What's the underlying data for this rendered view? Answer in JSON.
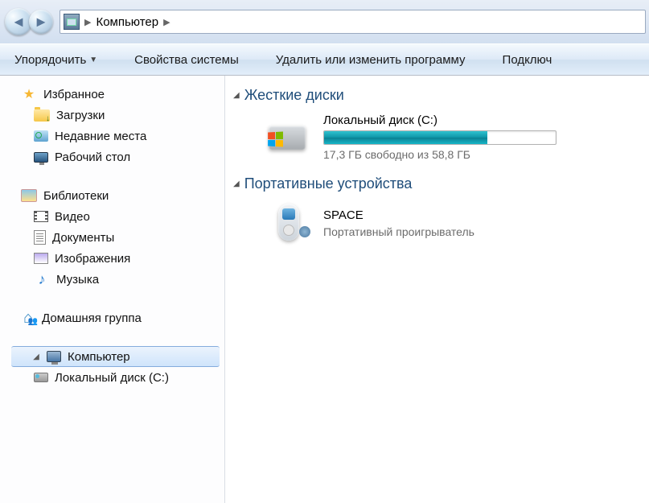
{
  "addressbar": {
    "location": "Компьютер"
  },
  "toolbar": {
    "organize": "Упорядочить",
    "sys_props": "Свойства системы",
    "uninstall": "Удалить или изменить программу",
    "connect": "Подключ"
  },
  "nav": {
    "favorites": "Избранное",
    "downloads": "Загрузки",
    "recent": "Недавние места",
    "desktop": "Рабочий стол",
    "libraries": "Библиотеки",
    "videos": "Видео",
    "documents": "Документы",
    "pictures": "Изображения",
    "music": "Музыка",
    "homegroup": "Домашняя группа",
    "computer": "Компьютер",
    "local_disk_c": "Локальный диск (C:)"
  },
  "groups": {
    "hdd": "Жесткие диски",
    "portable": "Портативные устройства"
  },
  "drives": {
    "c": {
      "name": "Локальный диск (C:)",
      "free_text": "17,3 ГБ свободно из 58,8 ГБ",
      "free_gb": 17.3,
      "total_gb": 58.8,
      "used_percent": 70.6
    }
  },
  "devices": {
    "space": {
      "name": "SPACE",
      "type": "Портативный проигрыватель"
    }
  }
}
